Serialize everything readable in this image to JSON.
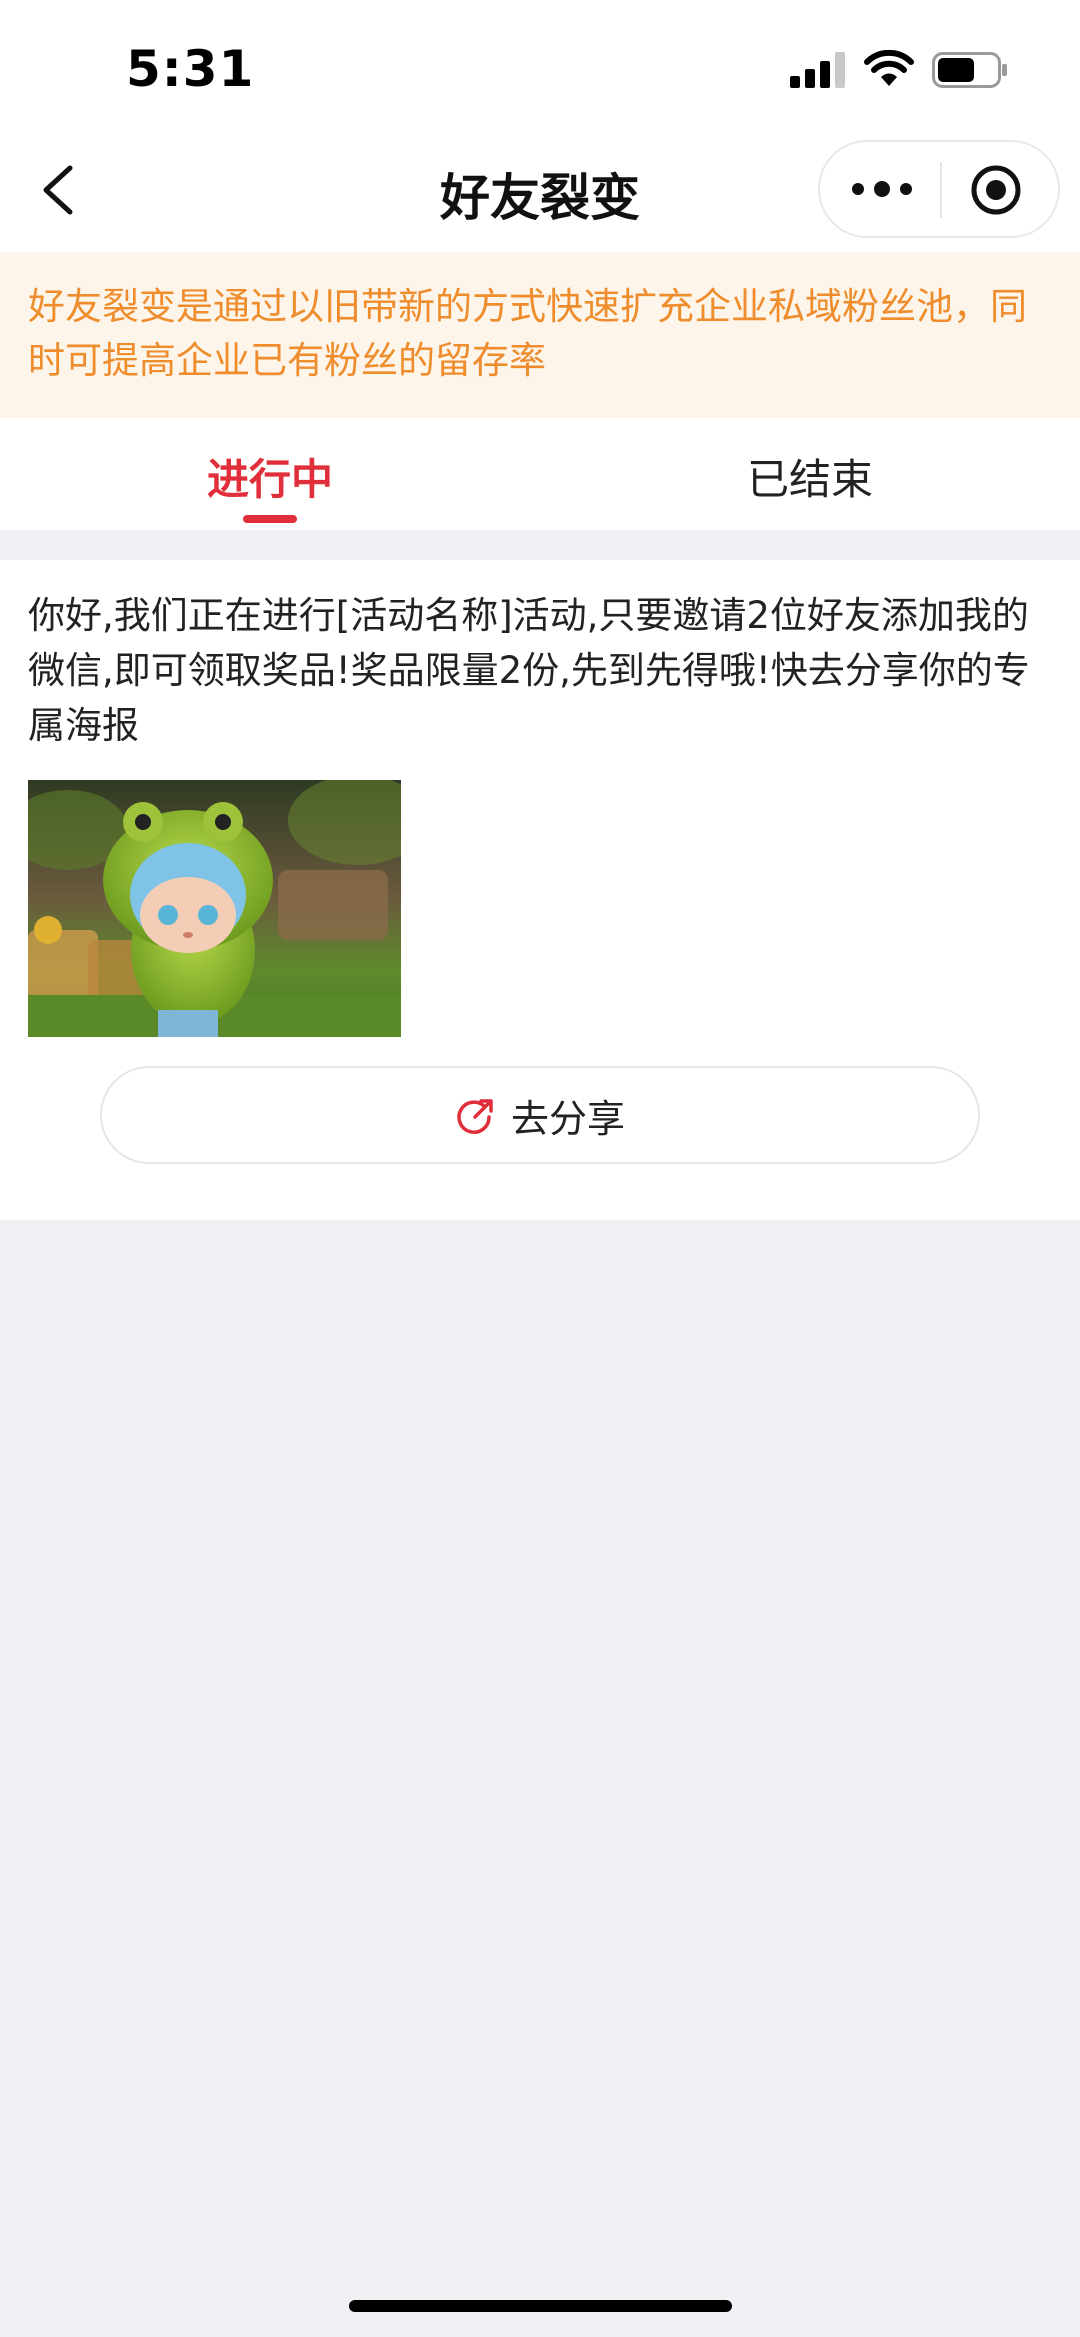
{
  "status_bar": {
    "time": "5:31"
  },
  "nav": {
    "title": "好友裂变"
  },
  "notice": {
    "text": "好友裂变是通过以旧带新的方式快速扩充企业私域粉丝池，同时可提高企业已有粉丝的留存率"
  },
  "tabs": [
    {
      "label": "进行中",
      "active": true
    },
    {
      "label": "已结束",
      "active": false
    }
  ],
  "activity": {
    "description": "你好,我们正在进行[活动名称]活动,只要邀请2位好友添加我的微信,即可领取奖品!奖品限量2份,先到先得哦!快去分享你的专属海报",
    "share_label": "去分享",
    "share_icon": "share-arrow-icon"
  },
  "colors": {
    "accent": "#e02f3a",
    "notice_text": "#ef8d2d",
    "notice_bg": "#fdf4ea",
    "page_bg": "#f0f1f5"
  }
}
